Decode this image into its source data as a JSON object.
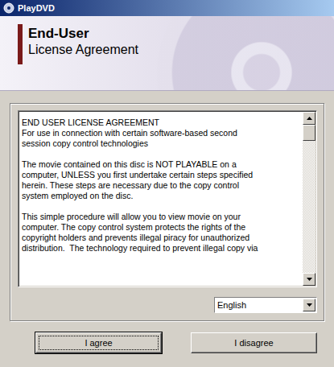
{
  "window": {
    "title": "PlayDVD"
  },
  "header": {
    "title": "End-User",
    "subtitle": "License Agreement"
  },
  "license": {
    "lines": [
      "END USER LICENSE AGREEMENT",
      "For use in connection with certain software-based second",
      "session copy control technologies",
      "",
      "The movie contained on this disc is NOT PLAYABLE on a",
      "computer, UNLESS you first undertake certain steps specified",
      "herein. These steps are necessary due to the copy control",
      "system employed on the disc.",
      "",
      "This simple procedure will allow you to view movie on your",
      "computer. The copy control system protects the rights of the",
      "copyright holders and prevents illegal piracy for unauthorized",
      "distribution.  The technology required to prevent illegal copy via"
    ],
    "scroll_position": 0
  },
  "language": {
    "value": "English"
  },
  "buttons": [
    {
      "label": "I agree",
      "focused": true
    },
    {
      "label": "I disagree",
      "focused": false
    }
  ]
}
